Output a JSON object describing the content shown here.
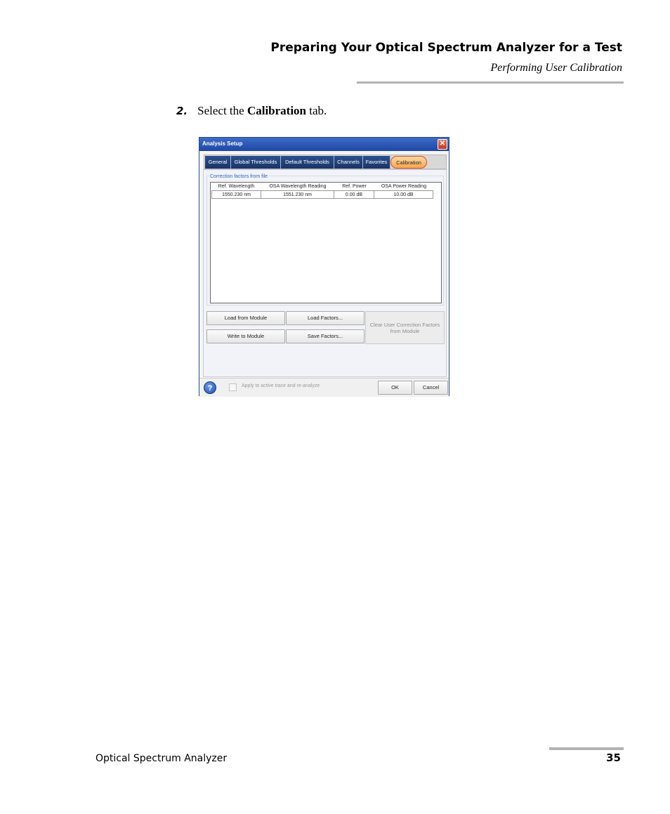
{
  "header": {
    "title": "Preparing Your Optical Spectrum Analyzer for a Test",
    "subtitle": "Performing User Calibration"
  },
  "step": {
    "number": "2.",
    "text_before": "Select the",
    "bold_word": "Calibration",
    "text_after": "tab."
  },
  "dialog": {
    "title": "Analysis Setup",
    "close_glyph": "✕",
    "tabs": [
      {
        "label": "General"
      },
      {
        "label": "Global Thresholds"
      },
      {
        "label": "Default Thresholds"
      },
      {
        "label": "Channels"
      },
      {
        "label": "Favorites"
      },
      {
        "label": "Calibration",
        "active": true
      }
    ],
    "group_label": "Correction factors from file",
    "table": {
      "columns": [
        "Ref. Wavelength",
        "OSA Wavelength Reading",
        "Ref. Power",
        "OSA Power Reading"
      ],
      "rows": [
        [
          "1550.230 nm",
          "1551.230 nm",
          "0.00 dB",
          "10.00 dB"
        ]
      ]
    },
    "buttons": {
      "load_from_module": "Load from Module",
      "load_factors": "Load Factors...",
      "write_to_module": "Write to Module",
      "save_factors": "Save Factors...",
      "clear_factors": "Clear User Correction Factors from Module"
    },
    "footer": {
      "help_glyph": "?",
      "checkbox_label": "Apply to active trace and re-analyze",
      "ok": "OK",
      "cancel": "Cancel"
    }
  },
  "page_footer": {
    "product": "Optical Spectrum Analyzer",
    "page_number": "35"
  }
}
